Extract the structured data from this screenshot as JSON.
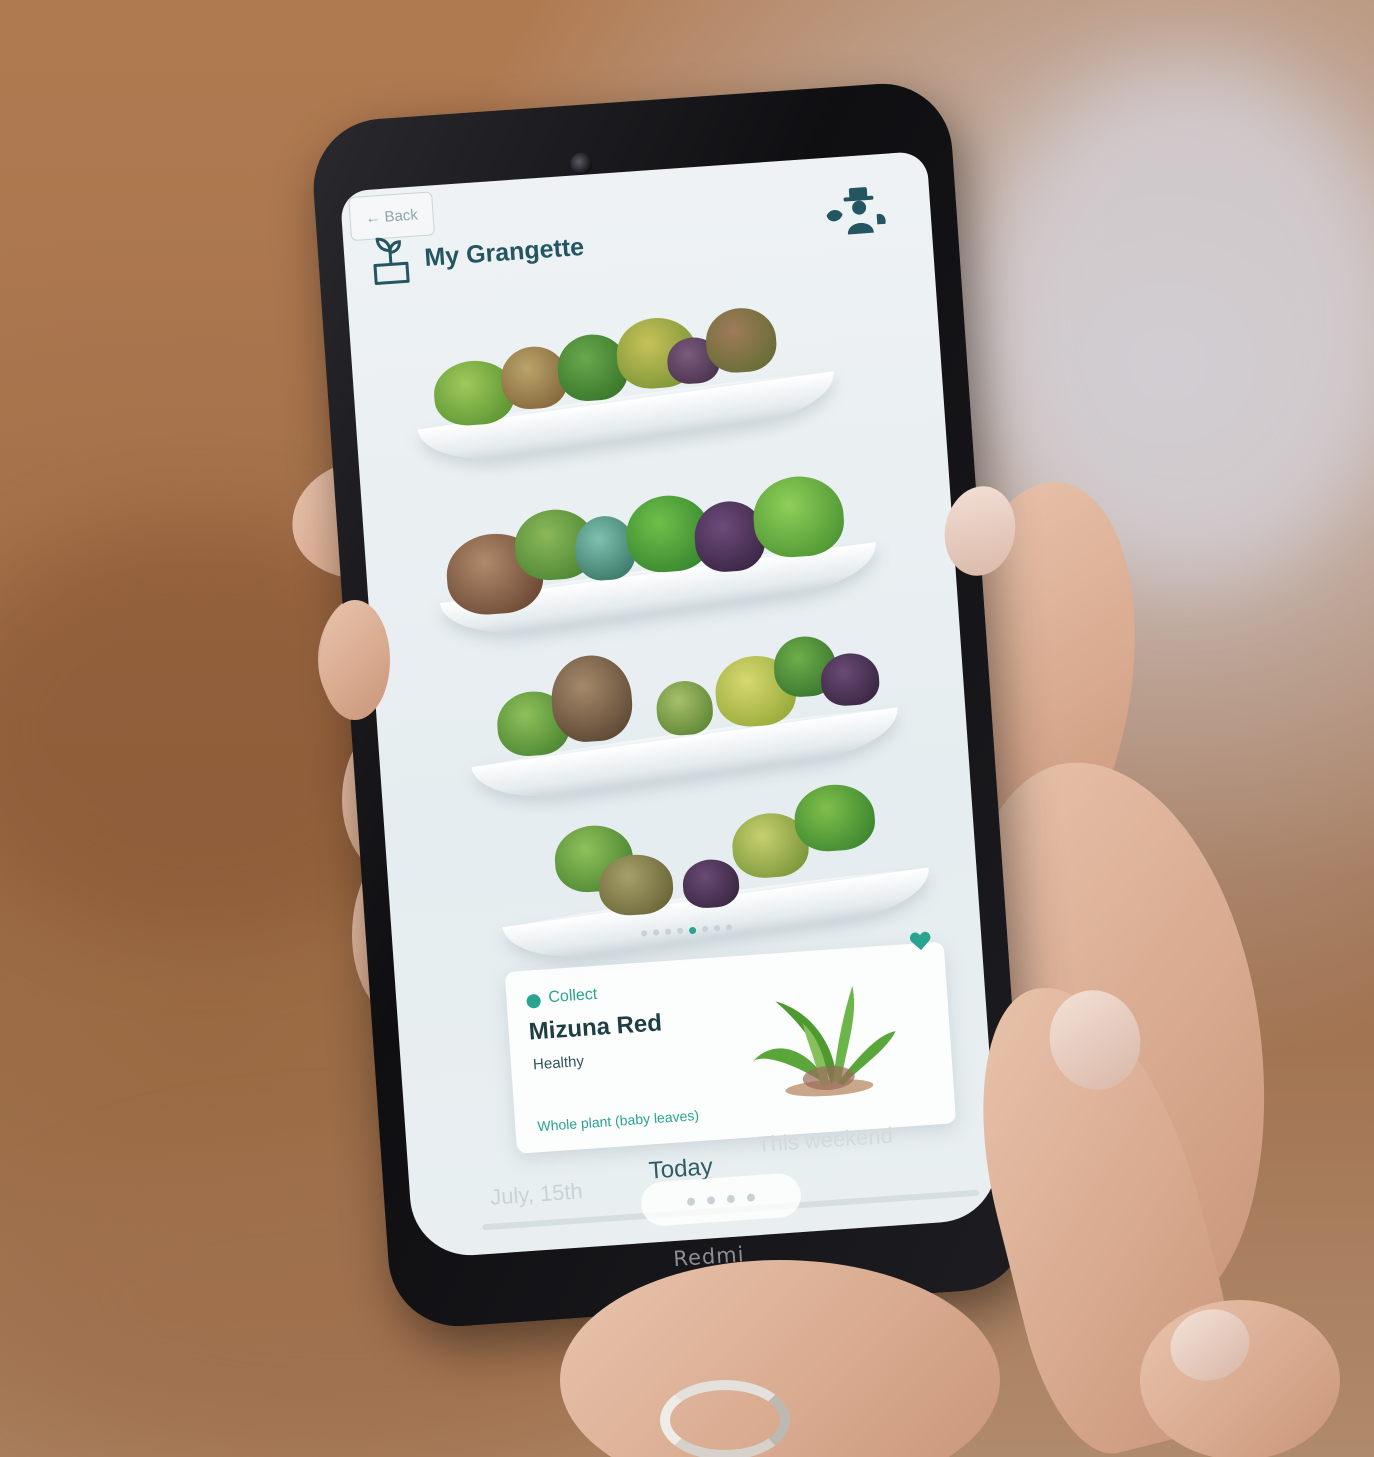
{
  "header": {
    "back_label": "← Back",
    "title": "My Grangette"
  },
  "carousel": {
    "page_count": 8,
    "active_index": 4
  },
  "plant_card": {
    "status": "Collect",
    "name": "Mizuna Red",
    "health": "Healthy",
    "harvest": "Whole plant (baby leaves)"
  },
  "timeline": {
    "past_label": "July, 15th",
    "current_label": "Today",
    "future_label": "This weekend"
  },
  "device": {
    "brand": "Redmi"
  },
  "colors": {
    "accent": "#2aa390",
    "title": "#235660",
    "screen_bg": "#eef2f4"
  }
}
